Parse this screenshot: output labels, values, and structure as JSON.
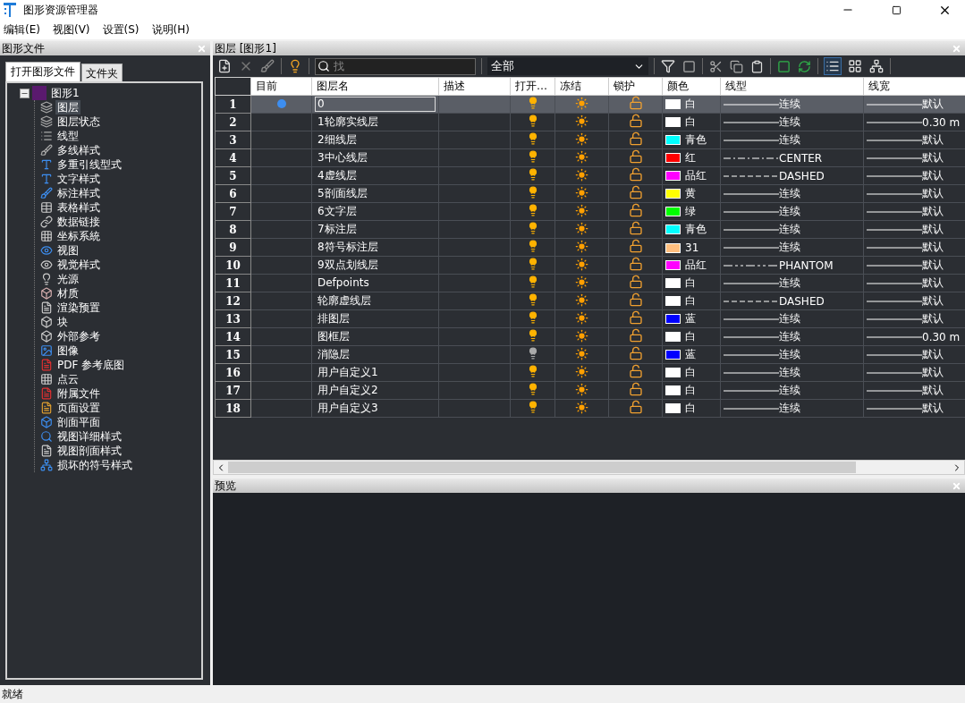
{
  "window": {
    "title": "图形资源管理器"
  },
  "menu": [
    "编辑(E)",
    "视图(V)",
    "设置(S)",
    "说明(H)"
  ],
  "left_panel": {
    "title": "图形文件",
    "tabs": [
      {
        "label": "打开图形文件",
        "selected": true
      },
      {
        "label": "文件夹",
        "selected": false
      }
    ],
    "tree": [
      {
        "label": "图形1",
        "expanded": true,
        "children": [
          {
            "label": "图层",
            "selected": true
          },
          {
            "label": "图层状态",
            "selected": false
          },
          {
            "label": "线型",
            "selected": false
          },
          {
            "label": "多线样式",
            "selected": false
          },
          {
            "label": "多重引线型式",
            "selected": false
          },
          {
            "label": "文字样式",
            "selected": false
          },
          {
            "label": "标注样式",
            "selected": false
          },
          {
            "label": "表格样式",
            "selected": false
          },
          {
            "label": "数据链接",
            "selected": false
          },
          {
            "label": "坐标系統",
            "selected": false
          },
          {
            "label": "视图",
            "selected": false
          },
          {
            "label": "视觉样式",
            "selected": false
          },
          {
            "label": "光源",
            "selected": false
          },
          {
            "label": "材质",
            "selected": false
          },
          {
            "label": "渲染预置",
            "selected": false
          },
          {
            "label": "块",
            "selected": false
          },
          {
            "label": "外部参考",
            "selected": false
          },
          {
            "label": "图像",
            "selected": false
          },
          {
            "label": "PDF 参考底图",
            "selected": false
          },
          {
            "label": "点云",
            "selected": false
          },
          {
            "label": "附属文件",
            "selected": false
          },
          {
            "label": "页面设置",
            "selected": false
          },
          {
            "label": "剖面平面",
            "selected": false
          },
          {
            "label": "视图详细样式",
            "selected": false
          },
          {
            "label": "视图剖面样式",
            "selected": false
          },
          {
            "label": "损坏的符号样式",
            "selected": false
          }
        ]
      }
    ]
  },
  "layers_panel": {
    "title": "图层 [图形1]",
    "search": {
      "placeholder": "找"
    },
    "filter": {
      "value": "全部"
    },
    "columns": [
      "目前",
      "图层名",
      "描述",
      "打开…",
      "冻结",
      "锁护",
      "颜色",
      "线型",
      "线宽"
    ],
    "rows": [
      {
        "num": "1",
        "current": true,
        "selected": true,
        "name": "0",
        "on": true,
        "frozen": false,
        "locked": false,
        "color": "#ffffff",
        "color_name": "白",
        "linetype": {
          "kind": "solid",
          "name": "连续"
        },
        "lineweight": "默认"
      },
      {
        "num": "2",
        "current": false,
        "selected": false,
        "name": "1轮廓实线层",
        "on": true,
        "frozen": false,
        "locked": false,
        "color": "#ffffff",
        "color_name": "白",
        "linetype": {
          "kind": "solid",
          "name": "连续"
        },
        "lineweight": "0.30 m"
      },
      {
        "num": "3",
        "current": false,
        "selected": false,
        "name": "2细线层",
        "on": true,
        "frozen": false,
        "locked": false,
        "color": "#00ffff",
        "color_name": "青色",
        "linetype": {
          "kind": "solid",
          "name": "连续"
        },
        "lineweight": "默认"
      },
      {
        "num": "4",
        "current": false,
        "selected": false,
        "name": "3中心线层",
        "on": true,
        "frozen": false,
        "locked": false,
        "color": "#ff0000",
        "color_name": "红",
        "linetype": {
          "kind": "center",
          "name": "CENTER"
        },
        "lineweight": "默认"
      },
      {
        "num": "5",
        "current": false,
        "selected": false,
        "name": "4虚线层",
        "on": true,
        "frozen": false,
        "locked": false,
        "color": "#ff00ff",
        "color_name": "品红",
        "linetype": {
          "kind": "dashed",
          "name": "DASHED"
        },
        "lineweight": "默认"
      },
      {
        "num": "6",
        "current": false,
        "selected": false,
        "name": "5剖面线层",
        "on": true,
        "frozen": false,
        "locked": false,
        "color": "#ffff00",
        "color_name": "黄",
        "linetype": {
          "kind": "solid",
          "name": "连续"
        },
        "lineweight": "默认"
      },
      {
        "num": "7",
        "current": false,
        "selected": false,
        "name": "6文字层",
        "on": true,
        "frozen": false,
        "locked": false,
        "color": "#00ff00",
        "color_name": "绿",
        "linetype": {
          "kind": "solid",
          "name": "连续"
        },
        "lineweight": "默认"
      },
      {
        "num": "8",
        "current": false,
        "selected": false,
        "name": "7标注层",
        "on": true,
        "frozen": false,
        "locked": false,
        "color": "#00ffff",
        "color_name": "青色",
        "linetype": {
          "kind": "solid",
          "name": "连续"
        },
        "lineweight": "默认"
      },
      {
        "num": "9",
        "current": false,
        "selected": false,
        "name": "8符号标注层",
        "on": true,
        "frozen": false,
        "locked": false,
        "color": "#ffbf7f",
        "color_name": "31",
        "linetype": {
          "kind": "solid",
          "name": "连续"
        },
        "lineweight": "默认"
      },
      {
        "num": "10",
        "current": false,
        "selected": false,
        "name": "9双点划线层",
        "on": true,
        "frozen": false,
        "locked": false,
        "color": "#ff00ff",
        "color_name": "品红",
        "linetype": {
          "kind": "phantom",
          "name": "PHANTOM"
        },
        "lineweight": "默认"
      },
      {
        "num": "11",
        "current": false,
        "selected": false,
        "name": "Defpoints",
        "on": true,
        "frozen": false,
        "locked": false,
        "color": "#ffffff",
        "color_name": "白",
        "linetype": {
          "kind": "solid",
          "name": "连续"
        },
        "lineweight": "默认"
      },
      {
        "num": "12",
        "current": false,
        "selected": false,
        "name": "轮廓虚线层",
        "on": true,
        "frozen": false,
        "locked": false,
        "color": "#ffffff",
        "color_name": "白",
        "linetype": {
          "kind": "dashed",
          "name": "DASHED"
        },
        "lineweight": "默认"
      },
      {
        "num": "13",
        "current": false,
        "selected": false,
        "name": "排图层",
        "on": true,
        "frozen": false,
        "locked": false,
        "color": "#0000ff",
        "color_name": "蓝",
        "linetype": {
          "kind": "solid",
          "name": "连续"
        },
        "lineweight": "默认"
      },
      {
        "num": "14",
        "current": false,
        "selected": false,
        "name": "图框层",
        "on": true,
        "frozen": false,
        "locked": false,
        "color": "#ffffff",
        "color_name": "白",
        "linetype": {
          "kind": "solid",
          "name": "连续"
        },
        "lineweight": "0.30 m"
      },
      {
        "num": "15",
        "current": false,
        "selected": false,
        "name": "消隐层",
        "on": false,
        "frozen": false,
        "locked": false,
        "color": "#0000ff",
        "color_name": "蓝",
        "linetype": {
          "kind": "solid",
          "name": "连续"
        },
        "lineweight": "默认"
      },
      {
        "num": "16",
        "current": false,
        "selected": false,
        "name": "用户自定义1",
        "on": true,
        "frozen": false,
        "locked": false,
        "color": "#ffffff",
        "color_name": "白",
        "linetype": {
          "kind": "solid",
          "name": "连续"
        },
        "lineweight": "默认"
      },
      {
        "num": "17",
        "current": false,
        "selected": false,
        "name": "用户自定义2",
        "on": true,
        "frozen": false,
        "locked": false,
        "color": "#ffffff",
        "color_name": "白",
        "linetype": {
          "kind": "solid",
          "name": "连续"
        },
        "lineweight": "默认"
      },
      {
        "num": "18",
        "current": false,
        "selected": false,
        "name": "用户自定义3",
        "on": true,
        "frozen": false,
        "locked": false,
        "color": "#ffffff",
        "color_name": "白",
        "linetype": {
          "kind": "solid",
          "name": "连续"
        },
        "lineweight": "默认"
      }
    ]
  },
  "preview_panel": {
    "title": "预览"
  },
  "status_bar": {
    "text": "就绪"
  }
}
